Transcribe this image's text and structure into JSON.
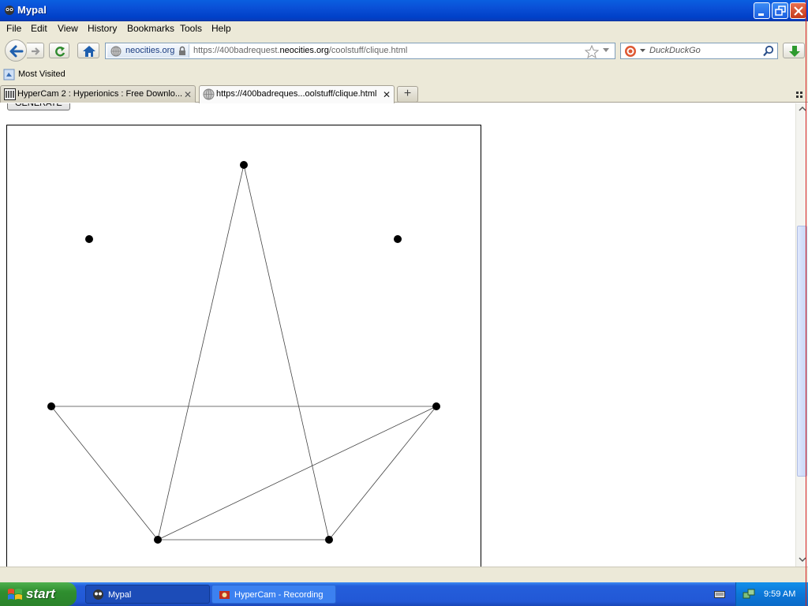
{
  "window": {
    "title": "Mypal"
  },
  "menu": {
    "items": [
      "File",
      "Edit",
      "View",
      "History",
      "Bookmarks",
      "Tools",
      "Help"
    ]
  },
  "navbar": {
    "identity_site": "neocities.org",
    "url_prefix": "https://400badrequest.",
    "url_domain": "neocities.org",
    "url_path": "/coolstuff/clique.html",
    "search_placeholder": "DuckDuckGo"
  },
  "bookmarks": {
    "most_visited": "Most Visited"
  },
  "tabs": [
    {
      "label": "HyperCam 2 : Hyperionics : Free Downlo...",
      "active": false
    },
    {
      "label": "https://400badreques...oolstuff/clique.html",
      "active": true
    }
  ],
  "page": {
    "generate_label": "GENERATE",
    "graph": {
      "nodes": [
        {
          "id": "top"
        },
        {
          "id": "upper-left"
        },
        {
          "id": "upper-right"
        },
        {
          "id": "mid-left"
        },
        {
          "id": "mid-right"
        },
        {
          "id": "bottom-left"
        },
        {
          "id": "bottom-right"
        }
      ],
      "edges": [
        [
          "top",
          "bottom-left"
        ],
        [
          "top",
          "bottom-right"
        ],
        [
          "mid-left",
          "mid-right"
        ],
        [
          "mid-left",
          "bottom-left"
        ],
        [
          "mid-right",
          "bottom-left"
        ],
        [
          "mid-right",
          "bottom-right"
        ],
        [
          "bottom-left",
          "bottom-right"
        ]
      ]
    }
  },
  "taskbar": {
    "start_label": "start",
    "items": [
      {
        "label": "Mypal",
        "active": true
      },
      {
        "label": "HyperCam - Recording",
        "active": false
      }
    ],
    "clock": "9:59 AM"
  },
  "colors": {
    "taskbar": "#245edb",
    "start": "#2f8e2f",
    "titlebar": "#0a4fd6"
  }
}
